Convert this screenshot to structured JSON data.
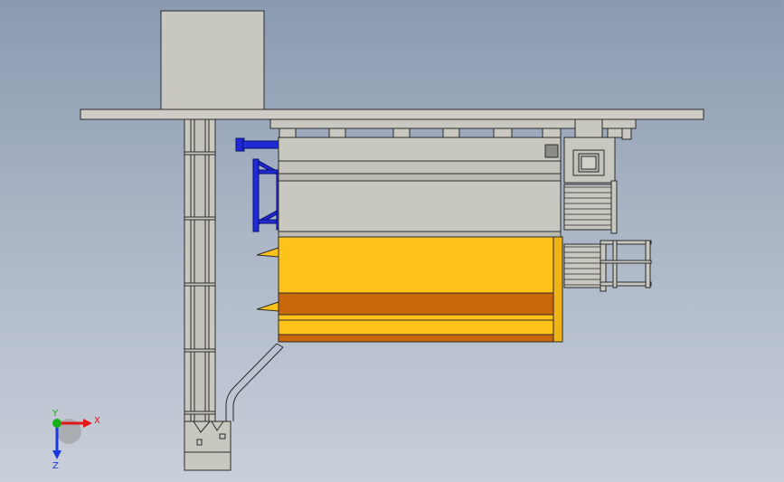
{
  "triad": {
    "x_label": "X",
    "y_label": "Y",
    "z_label": "Z"
  },
  "colors": {
    "background_top": "#8a9ab1",
    "background_bottom": "#c9cfda",
    "steel": "#c9c8c0",
    "edge": "#2b2b2b",
    "hopper_yellow": "#ffc21a",
    "hopper_orange": "#c8660a",
    "blue_bracket": "#1f2bd6",
    "axis_x": "#e01818",
    "axis_y": "#18b018",
    "axis_z": "#1838e0"
  }
}
